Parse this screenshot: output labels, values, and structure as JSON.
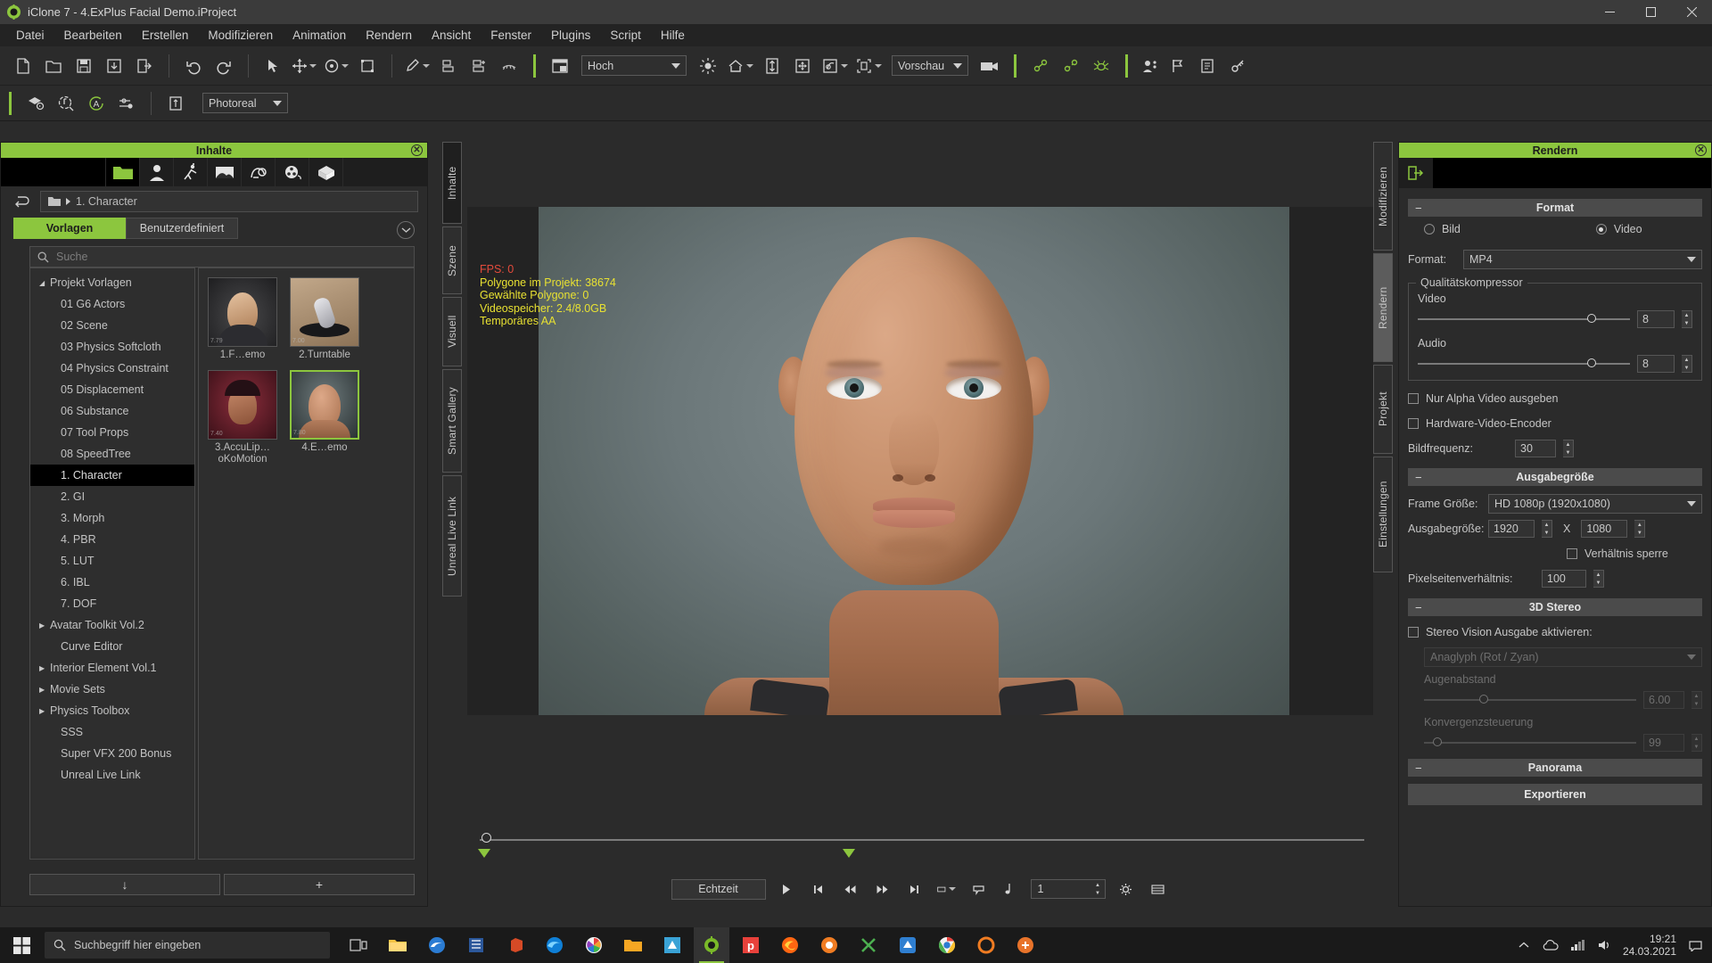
{
  "window": {
    "title": "iClone 7 - 4.ExPlus Facial Demo.iProject",
    "minimize": "—",
    "maximize": "❐",
    "close": "✕"
  },
  "menu": [
    "Datei",
    "Bearbeiten",
    "Erstellen",
    "Modifizieren",
    "Animation",
    "Rendern",
    "Ansicht",
    "Fenster",
    "Plugins",
    "Script",
    "Hilfe"
  ],
  "toolbar1": {
    "quality_select": "Hoch",
    "preview_select": "Vorschau",
    "icons": [
      "new-document-icon",
      "open-folder-icon",
      "save-icon",
      "import-icon",
      "export-icon",
      "undo-icon",
      "redo-icon",
      "select-tool-icon",
      "move-tool-icon",
      "rotate-tool-icon",
      "scale-tool-icon",
      "edit-pencil-icon",
      "align-icon",
      "align-offset-icon",
      "eyelash-icon",
      "layout-icon",
      "light-icon",
      "home-view-icon",
      "vertical-fit-icon",
      "move-view-icon",
      "orbit-icon",
      "frame-selection-icon",
      "camera-icon",
      "link-icon",
      "unlink-icon",
      "spider-icon",
      "persona-icon",
      "flag-icon",
      "note-icon",
      "key-icon"
    ]
  },
  "toolbar2": {
    "render_style_select": "Photoreal",
    "icons": [
      "material-icon",
      "scan-icon",
      "accu-icon",
      "settings-sliders-icon",
      "step-icon"
    ]
  },
  "content_panel": {
    "title": "Inhalte",
    "close_label": "✕",
    "category_tabs": [
      "folder-icon",
      "character-icon",
      "motion-icon",
      "scene-icon",
      "prop-tree-icon",
      "film-reel-icon",
      "package-icon"
    ],
    "breadcrumb": "1. Character",
    "tabs": [
      "Vorlagen",
      "Benutzerdefiniert"
    ],
    "active_tab": "Vorlagen",
    "search_placeholder": "Suche",
    "search_value": "",
    "tree": [
      {
        "label": "Projekt Vorlagen",
        "depth": 0,
        "arrow": "open",
        "selected": false
      },
      {
        "label": "01 G6 Actors",
        "depth": 1,
        "arrow": "",
        "selected": false
      },
      {
        "label": "02 Scene",
        "depth": 1,
        "arrow": "",
        "selected": false
      },
      {
        "label": "03 Physics Softcloth",
        "depth": 1,
        "arrow": "",
        "selected": false
      },
      {
        "label": "04 Physics Constraint",
        "depth": 1,
        "arrow": "",
        "selected": false
      },
      {
        "label": "05 Displacement",
        "depth": 1,
        "arrow": "",
        "selected": false
      },
      {
        "label": "06 Substance",
        "depth": 1,
        "arrow": "",
        "selected": false
      },
      {
        "label": "07 Tool Props",
        "depth": 1,
        "arrow": "",
        "selected": false
      },
      {
        "label": "08 SpeedTree",
        "depth": 1,
        "arrow": "",
        "selected": false
      },
      {
        "label": "1. Character",
        "depth": 1,
        "arrow": "",
        "selected": true
      },
      {
        "label": "2. GI",
        "depth": 1,
        "arrow": "",
        "selected": false
      },
      {
        "label": "3. Morph",
        "depth": 1,
        "arrow": "",
        "selected": false
      },
      {
        "label": "4. PBR",
        "depth": 1,
        "arrow": "",
        "selected": false
      },
      {
        "label": "5. LUT",
        "depth": 1,
        "arrow": "",
        "selected": false
      },
      {
        "label": "6. IBL",
        "depth": 1,
        "arrow": "",
        "selected": false
      },
      {
        "label": "7. DOF",
        "depth": 1,
        "arrow": "",
        "selected": false
      },
      {
        "label": "Avatar Toolkit Vol.2",
        "depth": 0,
        "arrow": "closed",
        "selected": false
      },
      {
        "label": "Curve Editor",
        "depth": 1,
        "arrow": "",
        "selected": false
      },
      {
        "label": "Interior Element Vol.1",
        "depth": 0,
        "arrow": "closed",
        "selected": false
      },
      {
        "label": "Movie Sets",
        "depth": 0,
        "arrow": "closed",
        "selected": false
      },
      {
        "label": "Physics Toolbox",
        "depth": 0,
        "arrow": "closed",
        "selected": false
      },
      {
        "label": "SSS",
        "depth": 1,
        "arrow": "",
        "selected": false
      },
      {
        "label": "Super VFX 200 Bonus",
        "depth": 1,
        "arrow": "",
        "selected": false
      },
      {
        "label": "Unreal Live Link",
        "depth": 1,
        "arrow": "",
        "selected": false
      }
    ],
    "thumbnails": [
      {
        "label": "1.F…emo",
        "badge": "7.79",
        "selected": false,
        "kind": "male-head"
      },
      {
        "label": "2.Turntable",
        "badge": "7.00",
        "selected": false,
        "kind": "turntable"
      },
      {
        "label": "3.AccuLip…oKoMotion",
        "badge": "7.40",
        "selected": false,
        "kind": "red-head"
      },
      {
        "label": "4.E…emo",
        "badge": "7.80",
        "selected": true,
        "kind": "female-head"
      }
    ],
    "bottom_buttons": [
      "↓",
      "+"
    ]
  },
  "dock_left_tabs": [
    "Inhalte",
    "Szene",
    "Visuell",
    "Smart Gallery",
    "Unreal Live Link"
  ],
  "dock_right_tabs": [
    "Modifizieren",
    "Rendern",
    "Projekt",
    "Einstellungen"
  ],
  "dock_right_active": "Rendern",
  "viewport": {
    "hud": {
      "fps": "FPS: 0",
      "polygons_project": "Polygone im Projekt: 38674",
      "polygons_selected": "Gewählte Polygone: 0",
      "video_memory": "Videospeicher: 2.4/8.0GB",
      "temporal_aa": "Temporäres AA"
    }
  },
  "timeline": {
    "realtime_button": "Echtzeit",
    "frame_value": "1",
    "transport_icons": [
      "play-icon",
      "jump-start-icon",
      "step-back-icon",
      "step-forward-icon",
      "jump-end-icon",
      "range-icon",
      "marker-icon",
      "note-icon"
    ],
    "settings_icon": "gear-icon",
    "list_icon": "list-icon"
  },
  "render_panel": {
    "title": "Rendern",
    "close_label": "✕",
    "sections": {
      "format": {
        "header": "Format",
        "image_label": "Bild",
        "video_label": "Video",
        "selected": "Video",
        "format_label": "Format:",
        "format_value": "MP4",
        "quality_group": "Qualitätskompressor",
        "video_label2": "Video",
        "video_value": "8",
        "audio_label": "Audio",
        "audio_value": "8",
        "alpha_only": "Nur Alpha Video ausgeben",
        "hw_encoder": "Hardware-Video-Encoder",
        "framerate_label": "Bildfrequenz:",
        "framerate_value": "30"
      },
      "output_size": {
        "header": "Ausgabegröße",
        "frame_size_label": "Frame Größe:",
        "frame_size_value": "HD 1080p (1920x1080)",
        "output_size_label": "Ausgabegröße:",
        "width": "1920",
        "x": "X",
        "height": "1080",
        "lock_ratio": "Verhältnis sperre",
        "pixel_ratio_label": "Pixelseitenverhältnis:",
        "pixel_ratio_value": "100"
      },
      "stereo": {
        "header": "3D Stereo",
        "enable_label": "Stereo Vision Ausgabe aktivieren:",
        "mode_value": "Anaglyph (Rot / Zyan)",
        "eye_distance_label": "Augenabstand",
        "eye_distance_value": "6.00",
        "convergence_label": "Konvergenzsteuerung",
        "convergence_value": "99"
      },
      "panorama": {
        "header": "Panorama"
      },
      "export_button": "Exportieren"
    }
  },
  "taskbar": {
    "search_placeholder": "Suchbegriff hier eingeben",
    "time": "19:21",
    "date": "24.03.2021",
    "apps": [
      "task-view-icon",
      "file-explorer-icon",
      "edge-icon",
      "excel-like-icon",
      "office-icon",
      "edge-chromium-icon",
      "photos-icon",
      "folder-icon",
      "reallusion-cc-icon",
      "iclone-icon",
      "p-app-icon",
      "firefox-icon",
      "orange-app-icon",
      "x-green-icon",
      "blue-app-icon",
      "chrome-icon",
      "orange-ring-icon",
      "orange-circle-icon"
    ],
    "tray": [
      "chevron-up-icon",
      "onedrive-icon",
      "network-icon",
      "volume-icon"
    ]
  },
  "colors": {
    "accent_green": "#8cc63e",
    "panel_bg": "#2b2b2b",
    "dark_bg": "#232323",
    "hud_red": "#e44b3c",
    "hud_yellow": "#e8e132"
  }
}
